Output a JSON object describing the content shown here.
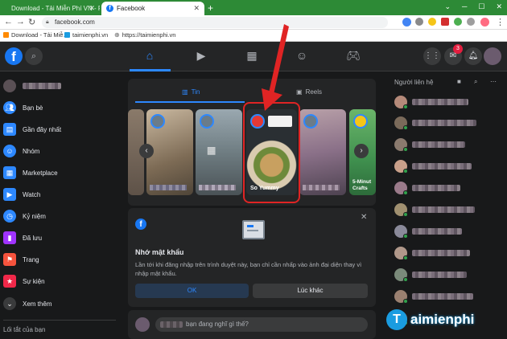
{
  "browser": {
    "tabs": [
      {
        "label": "Download - Tải Miễn Phí VN - P…",
        "active": false
      },
      {
        "label": "Facebook",
        "active": true
      }
    ],
    "new_tab": "+",
    "url": "facebook.com",
    "bookmarks": [
      "Download - Tải Miễ…",
      "taimienphi.vn",
      "https://taimienphi.vn"
    ]
  },
  "header": {
    "logo": "f",
    "nav_icons": [
      "home-icon",
      "watch-icon",
      "marketplace-icon",
      "groups-icon",
      "gaming-icon"
    ],
    "messenger_badge": "3"
  },
  "sidebar": {
    "items": [
      {
        "label": "Bạn bè",
        "icon": "friends-icon",
        "color": "#2d88ff"
      },
      {
        "label": "Gần đây nhất",
        "icon": "recent-icon",
        "color": "#2d88ff"
      },
      {
        "label": "Nhóm",
        "icon": "groups-icon",
        "color": "#2d88ff"
      },
      {
        "label": "Marketplace",
        "icon": "marketplace-icon",
        "color": "#2d88ff"
      },
      {
        "label": "Watch",
        "icon": "watch-icon",
        "color": "#2d88ff"
      },
      {
        "label": "Kỷ niệm",
        "icon": "memories-icon",
        "color": "#2d88ff"
      },
      {
        "label": "Đã lưu",
        "icon": "saved-icon",
        "color": "#a033ff"
      },
      {
        "label": "Trang",
        "icon": "pages-icon",
        "color": "#f5533d"
      },
      {
        "label": "Sự kiện",
        "icon": "events-icon",
        "color": "#f02849"
      },
      {
        "label": "Xem thêm",
        "icon": "chevron-down-icon",
        "color": "#3a3b3c"
      }
    ],
    "shortcuts_title": "Lối tắt của bạn"
  },
  "stories": {
    "tabs": [
      {
        "label": "Tin",
        "active": true
      },
      {
        "label": "Reels",
        "active": false
      }
    ],
    "highlighted_label": "So Yummy",
    "last_label": "5-Minut Crafts"
  },
  "password_prompt": {
    "title": "Nhớ mật khẩu",
    "description": "Lần tới khi đăng nhập trên trình duyệt này, bạn chỉ cần nhấp vào ảnh đại diện thay vì nhập mật khẩu.",
    "ok": "OK",
    "later": "Lúc khác"
  },
  "composer": {
    "placeholder": "bạn đang nghĩ gì thế?"
  },
  "contacts": {
    "title": "Người liên hệ"
  },
  "watermark": {
    "text": "aimienphi",
    "logo_letter": "T"
  }
}
